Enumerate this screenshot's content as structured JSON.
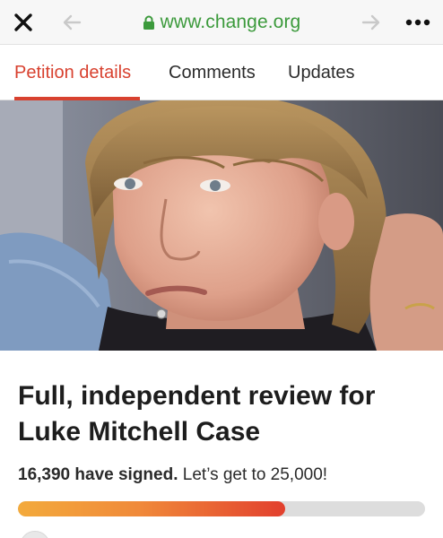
{
  "browser": {
    "url": "www.change.org",
    "icons": {
      "close": "close-icon",
      "back": "back-arrow-icon",
      "forward": "forward-arrow-icon",
      "lock": "lock-icon",
      "more": "more-dots-icon"
    }
  },
  "tabs": [
    {
      "label": "Petition details",
      "active": true
    },
    {
      "label": "Comments",
      "active": false
    },
    {
      "label": "Updates",
      "active": false
    }
  ],
  "petition": {
    "title": "Full, independent review for Luke Mitchell Case",
    "signed_count": "16,390 have signed.",
    "goal_text": " Let’s get to 25,000!",
    "progress_fraction": 0.6556
  },
  "colors": {
    "accent": "#d8412f",
    "url_green": "#3c9a3c",
    "progress_start": "#f3aa3c",
    "progress_end": "#e2402e"
  }
}
